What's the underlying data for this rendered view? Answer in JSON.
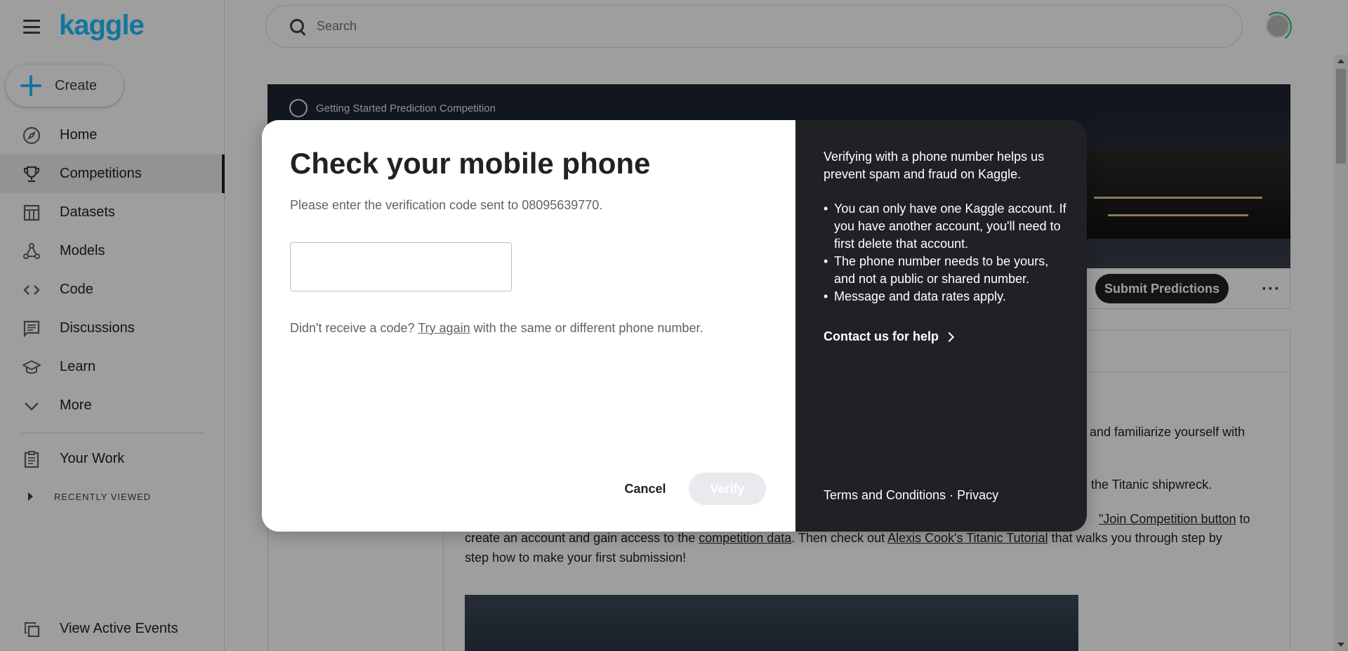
{
  "sidebar": {
    "logo": "kaggle",
    "create_label": "Create",
    "items": [
      {
        "label": "Home",
        "icon": "compass-icon"
      },
      {
        "label": "Competitions",
        "icon": "trophy-icon"
      },
      {
        "label": "Datasets",
        "icon": "table-icon"
      },
      {
        "label": "Models",
        "icon": "models-icon"
      },
      {
        "label": "Code",
        "icon": "code-icon"
      },
      {
        "label": "Discussions",
        "icon": "comment-icon"
      },
      {
        "label": "Learn",
        "icon": "school-icon"
      },
      {
        "label": "More",
        "icon": "chevron-down-icon"
      }
    ],
    "your_work": "Your Work",
    "recently_viewed": "RECENTLY VIEWED",
    "view_active_events": "View Active Events"
  },
  "search": {
    "placeholder": "Search"
  },
  "competition": {
    "badge": "Getting Started Prediction Competition",
    "submit_label": "Submit Predictions",
    "more_label": "···",
    "para1": "and familiarize yourself with",
    "para2": "the Titanic shipwreck.",
    "para3_link": "\"Join Competition button",
    "para3_after": " to",
    "para4_pre": "create an account and gain access to the ",
    "para4_link1": "competition data",
    "para4_mid": ". Then check out ",
    "para4_link2": "Alexis Cook's Titanic Tutorial",
    "para4_post": " that walks you through step by",
    "para5": "step how to make your first submission!"
  },
  "modal": {
    "title": "Check your mobile phone",
    "subtitle": "Please enter the verification code sent to 08095639770.",
    "code_value": "",
    "resend_prefix": "Didn't receive a code? ",
    "resend_link": "Try again",
    "resend_suffix": " with the same or different phone number.",
    "cancel_label": "Cancel",
    "verify_label": "Verify",
    "info_intro": "Verifying with a phone number helps us prevent spam and fraud on Kaggle.",
    "info_points": [
      "You can only have one Kaggle account. If you have another account, you'll need to first delete that account.",
      "The phone number needs to be yours, and not a public or shared number.",
      "Message and data rates apply."
    ],
    "help_label": "Contact us for help",
    "terms_label": "Terms and Conditions",
    "separator": " · ",
    "privacy_label": "Privacy"
  },
  "colors": {
    "brand": "#20beff",
    "dark": "#202124",
    "progress_ring": "#1dbd5a"
  }
}
